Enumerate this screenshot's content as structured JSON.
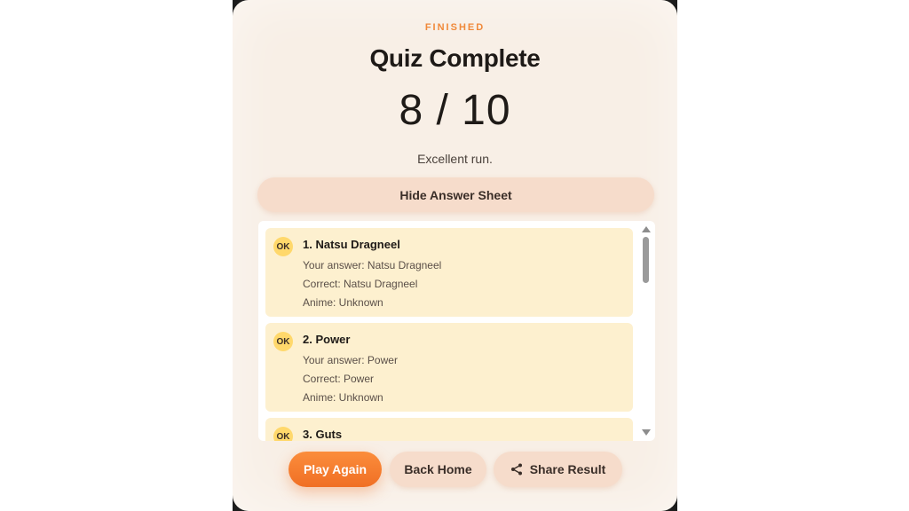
{
  "header": {
    "eyebrow": "FINISHED",
    "title": "Quiz Complete",
    "score": "8 / 10",
    "message": "Excellent run."
  },
  "toggle": {
    "label": "Hide Answer Sheet"
  },
  "answers": [
    {
      "badge": "OK",
      "title": "1. Natsu Dragneel",
      "your_answer": "Your answer: Natsu Dragneel",
      "correct": "Correct: Natsu Dragneel",
      "anime": "Anime: Unknown"
    },
    {
      "badge": "OK",
      "title": "2. Power",
      "your_answer": "Your answer: Power",
      "correct": "Correct: Power",
      "anime": "Anime: Unknown"
    },
    {
      "badge": "OK",
      "title": "3. Guts",
      "your_answer": "",
      "correct": "",
      "anime": ""
    }
  ],
  "actions": {
    "play_again": "Play Again",
    "back_home": "Back Home",
    "share_result": "Share Result"
  },
  "colors": {
    "accent": "#f0893a",
    "primary_button": "#f06f24",
    "card_background": "#f8efe6",
    "answer_background": "#fdf0cf",
    "badge": "#ffd86b"
  },
  "icons": {
    "share": "share-icon",
    "scroll_up": "scroll-up-arrow-icon",
    "scroll_down": "scroll-down-arrow-icon"
  }
}
